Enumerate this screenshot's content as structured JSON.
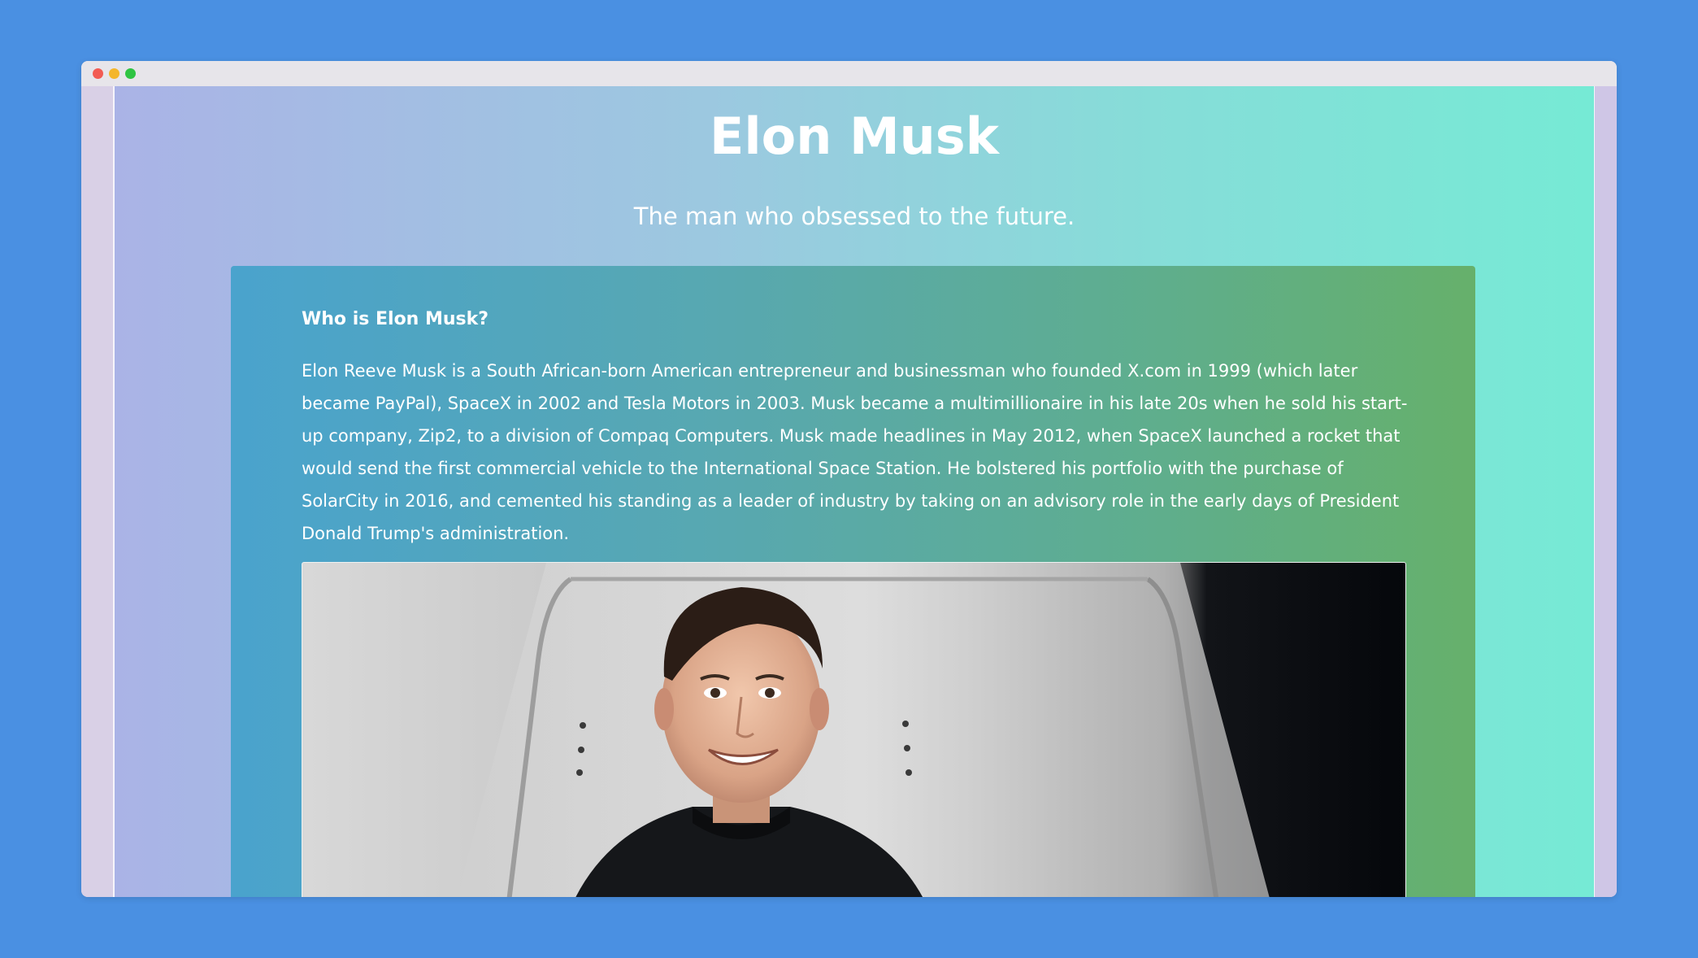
{
  "window": {
    "controls": [
      "close",
      "minimize",
      "maximize"
    ],
    "control_colors": {
      "close": "#f25b53",
      "minimize": "#f4b62b",
      "maximize": "#2fc443"
    }
  },
  "page": {
    "title": "Elon Musk",
    "subtitle": "The man who obsessed to the future.",
    "background_gradient": [
      "#aab3e6",
      "#76ead5"
    ]
  },
  "card": {
    "heading": "Who is Elon Musk?",
    "paragraph": "Elon Reeve Musk is a South African-born American entrepreneur and businessman who founded X.com in 1999 (which later became PayPal), SpaceX in 2002 and Tesla Motors in 2003. Musk became a multimillionaire in his late 20s when he sold his start-up company, Zip2, to a division of Compaq Computers. Musk made headlines in May 2012, when SpaceX launched a rocket that would send the first commercial vehicle to the International Space Station. He bolstered his portfolio with the purchase of SolarCity in 2016, and cemented his standing as a leader of industry by taking on an advisory role in the early days of President Donald Trump's administration.",
    "background_gradient": [
      "#4aa3cd",
      "#66b06b"
    ]
  },
  "photo": {
    "subject": "portrait of a smiling man in a black t-shirt in front of a metal spacecraft capsule"
  }
}
